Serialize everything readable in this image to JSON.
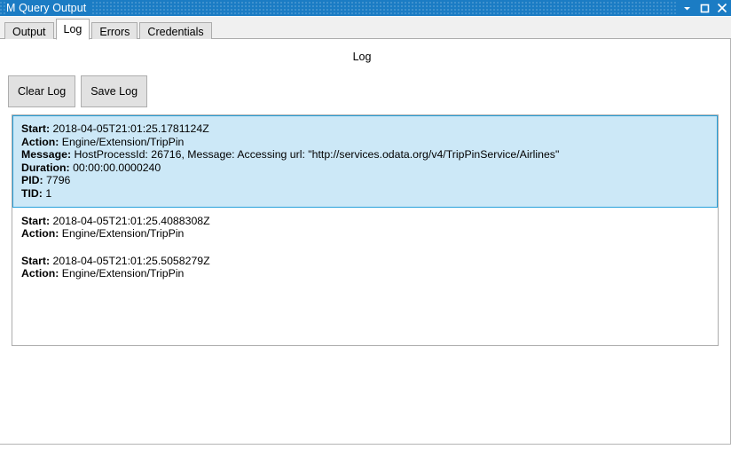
{
  "window": {
    "title": "M Query Output",
    "controls": [
      {
        "name": "minimize-icon",
        "label": "Minimize"
      },
      {
        "name": "maximize-icon",
        "label": "Maximize"
      },
      {
        "name": "close-icon",
        "label": "Close"
      }
    ]
  },
  "tabs": [
    {
      "label": "Output",
      "active": false
    },
    {
      "label": "Log",
      "active": true
    },
    {
      "label": "Errors",
      "active": false
    },
    {
      "label": "Credentials",
      "active": false
    }
  ],
  "page": {
    "title": "Log"
  },
  "toolbar": {
    "clear_log_label": "Clear Log",
    "save_log_label": "Save Log"
  },
  "log": {
    "entries": [
      {
        "selected": true,
        "lines": [
          {
            "key": "Start:",
            "value": "2018-04-05T21:01:25.1781124Z"
          },
          {
            "key": "Action:",
            "value": "Engine/Extension/TripPin"
          },
          {
            "key": "Message:",
            "value": "HostProcessId: 26716, Message: Accessing url: \"http://services.odata.org/v4/TripPinService/Airlines\""
          },
          {
            "key": "Duration:",
            "value": "00:00:00.0000240"
          },
          {
            "key": "PID:",
            "value": "7796"
          },
          {
            "key": "TID:",
            "value": "1"
          }
        ]
      },
      {
        "selected": false,
        "lines": [
          {
            "key": "Start:",
            "value": "2018-04-05T21:01:25.4088308Z"
          },
          {
            "key": "Action:",
            "value": "Engine/Extension/TripPin"
          }
        ]
      },
      {
        "selected": false,
        "lines": [
          {
            "key": "Start:",
            "value": "2018-04-05T21:01:25.5058279Z"
          },
          {
            "key": "Action:",
            "value": "Engine/Extension/TripPin"
          }
        ]
      }
    ]
  },
  "colors": {
    "titlebar": "#1b7cc4",
    "selection_fill": "#cce8f7",
    "selection_border": "#26a0da",
    "button_face": "#e1e1e1"
  }
}
